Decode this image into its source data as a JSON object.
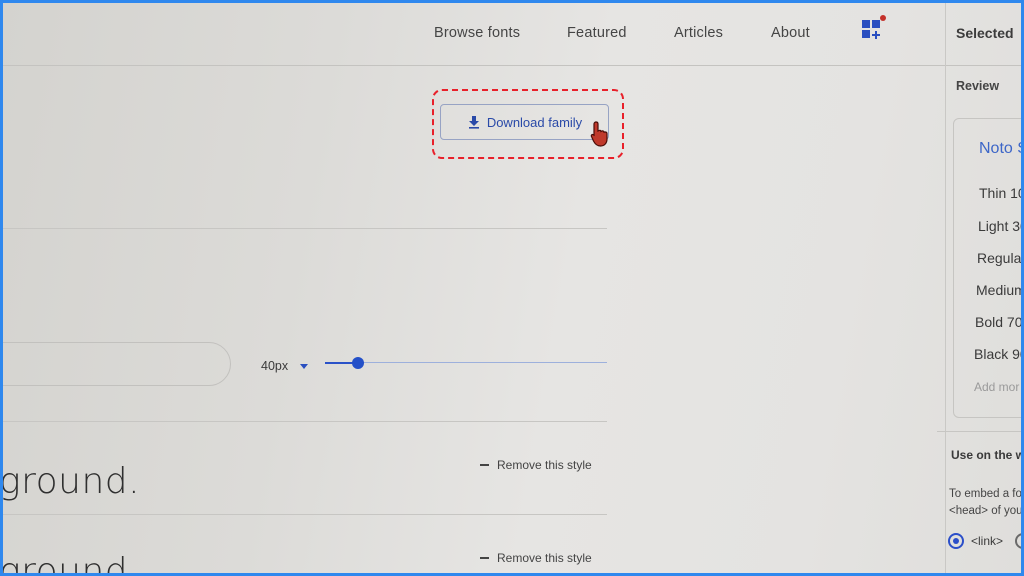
{
  "nav": {
    "items": [
      "Browse fonts",
      "Featured",
      "Articles",
      "About"
    ],
    "selected_label": "Selected"
  },
  "main": {
    "download_label": "Download family",
    "size_value": "40px",
    "size_slider_fraction": 0.12,
    "previews": [
      {
        "text": "ground.",
        "remove_label": "Remove this style"
      },
      {
        "text": "ground.",
        "remove_label": "Remove this style"
      }
    ]
  },
  "side_panel": {
    "review_label": "Review",
    "font_name": "Noto S",
    "weights": [
      "Thin 10",
      "Light 30",
      "Regular",
      "Medium",
      "Bold 70",
      "Black 90"
    ],
    "add_more": "Add mor",
    "use_on_web": "Use on the w",
    "embed_text_1": "To embed a fo",
    "embed_text_2": "<head> of you",
    "link_option": "<link>"
  },
  "colors": {
    "accent": "#2a4aa8",
    "highlight": "#e8202a",
    "frame": "#2f88ee"
  }
}
